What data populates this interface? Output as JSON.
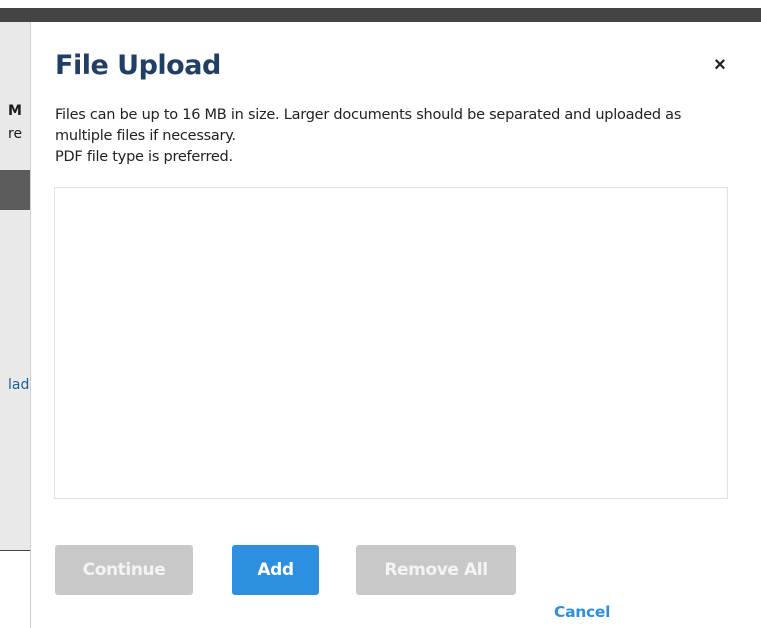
{
  "background": {
    "fragment_1": "M",
    "fragment_2": "re",
    "fragment_3": "lad"
  },
  "dialog": {
    "title": "File Upload",
    "close_label": "×",
    "intro_line_1": "Files can be up to 16 MB in size. Larger documents should be separated and uploaded as multiple files if necessary.",
    "intro_line_2": "PDF file type is preferred.",
    "drop_area_text": ""
  },
  "buttons": {
    "continue_label": "Continue",
    "continue_enabled": false,
    "add_label": "Add",
    "add_enabled": true,
    "remove_all_label": "Remove All",
    "remove_all_enabled": false,
    "cancel_label": "Cancel"
  },
  "colors": {
    "title": "#1f3f66",
    "primary_button": "#2c8fe0",
    "disabled_button": "#c8c8c8",
    "cancel_link": "#2c8fe0",
    "overlay": "#444444"
  }
}
